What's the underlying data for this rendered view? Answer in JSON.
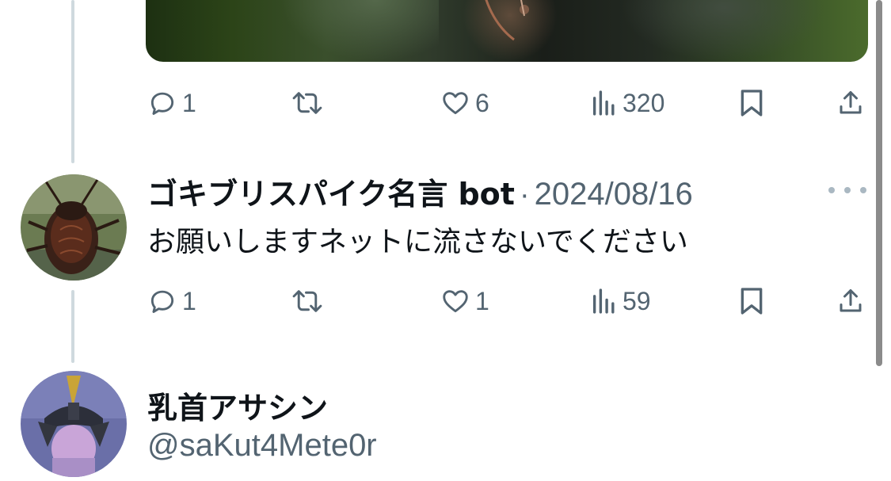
{
  "tweets": [
    {
      "actions": {
        "reply_count": "1",
        "like_count": "6",
        "view_count": "320"
      }
    },
    {
      "display_name": "ゴキブリスパイク名言 bot",
      "separator": "·",
      "timestamp": "2024/08/16",
      "text": "お願いしますネットに流さないでください",
      "actions": {
        "reply_count": "1",
        "like_count": "1",
        "view_count": "59"
      }
    },
    {
      "display_name": "乳首アサシン",
      "handle": "@saKut4Mete0r"
    }
  ],
  "icons": {
    "reply": "reply-icon",
    "retweet": "retweet-icon",
    "like": "like-icon",
    "views": "views-icon",
    "bookmark": "bookmark-icon",
    "share": "share-icon",
    "more": "more-icon"
  },
  "colors": {
    "secondary_text": "#536471",
    "primary_text": "#0f1419",
    "thread_line": "#cfd9de"
  }
}
